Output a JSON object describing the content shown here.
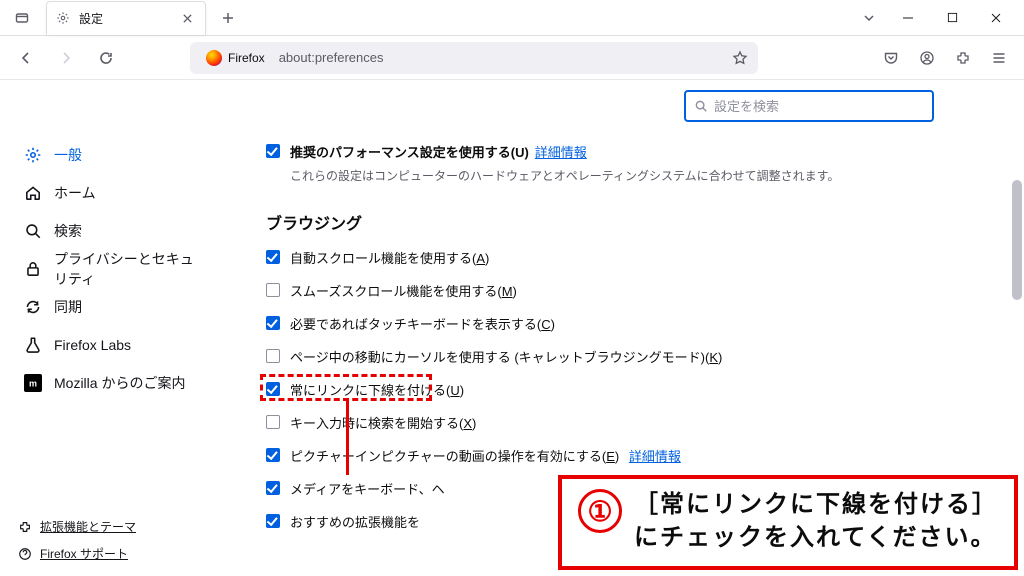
{
  "tab": {
    "title": "設定"
  },
  "url": {
    "chip": "Firefox",
    "path": "about:preferences"
  },
  "search": {
    "placeholder": "設定を検索"
  },
  "sidebar": {
    "items": [
      {
        "label": "一般"
      },
      {
        "label": "ホーム"
      },
      {
        "label": "検索"
      },
      {
        "label": "プライバシーとセキュリティ"
      },
      {
        "label": "同期"
      },
      {
        "label": "Firefox Labs"
      },
      {
        "label": "Mozilla からのご案内"
      }
    ],
    "links": [
      {
        "label": "拡張機能とテーマ"
      },
      {
        "label": "Firefox サポート"
      }
    ]
  },
  "perf": {
    "label": "推奨のパフォーマンス設定を使用する(U)",
    "detail": "詳細情報",
    "sub": "これらの設定はコンピューターのハードウェアとオペレーティングシステムに合わせて調整されます。"
  },
  "section_browsing": "ブラウジング",
  "opts": [
    {
      "checked": true,
      "label": "自動スクロール機能を使用する(A)"
    },
    {
      "checked": false,
      "label": "スムーズスクロール機能を使用する(M)"
    },
    {
      "checked": true,
      "label": "必要であればタッチキーボードを表示する(C)"
    },
    {
      "checked": false,
      "label": "ページ中の移動にカーソルを使用する (キャレットブラウジングモード)(K)"
    },
    {
      "checked": true,
      "label": "常にリンクに下線を付ける(U)"
    },
    {
      "checked": false,
      "label": "キー入力時に検索を開始する(X)"
    },
    {
      "checked": true,
      "label": "ピクチャーインピクチャーの動画の操作を有効にする(E)",
      "detail": "詳細情報"
    },
    {
      "checked": true,
      "label": "メディアをキーボード、ヘ"
    },
    {
      "checked": true,
      "label": "おすすめの拡張機能を"
    }
  ],
  "callout": {
    "num": "①",
    "line1": "［常にリンクに下線を付ける］",
    "line2": "にチェックを入れてください。"
  }
}
